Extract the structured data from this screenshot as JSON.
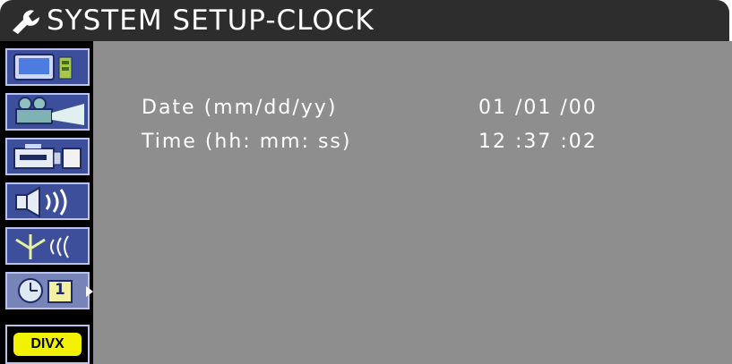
{
  "window": {
    "title": "SYSTEM SETUP-CLOCK",
    "title_icon": "wrench-icon"
  },
  "sidebar": {
    "items": [
      {
        "id": "tv",
        "icon": "tv-display-icon",
        "active": false
      },
      {
        "id": "projector",
        "icon": "movie-projector-icon",
        "active": false
      },
      {
        "id": "camcorder",
        "icon": "camcorder-icon",
        "active": false
      },
      {
        "id": "speaker",
        "icon": "speaker-sound-icon",
        "active": false
      },
      {
        "id": "antenna",
        "icon": "antenna-signal-icon",
        "active": false
      },
      {
        "id": "clock",
        "icon": "clock-calendar-icon",
        "active": true,
        "calendar_number": "1"
      }
    ],
    "divx_label": "DIVX"
  },
  "clock": {
    "date_label": "Date (mm/dd/yy)",
    "date_value": "01 /01 /00",
    "time_label": "Time (hh: mm: ss)",
    "time_value": "12 :37 :02"
  },
  "colors": {
    "titlebar": "#2d2d2d",
    "content_bg": "#8e8e8e",
    "sidebar_bg": "#000000",
    "button_bg": "#3d4f9a",
    "button_border": "#b9c3ee",
    "divx_yellow": "#f2f200"
  }
}
